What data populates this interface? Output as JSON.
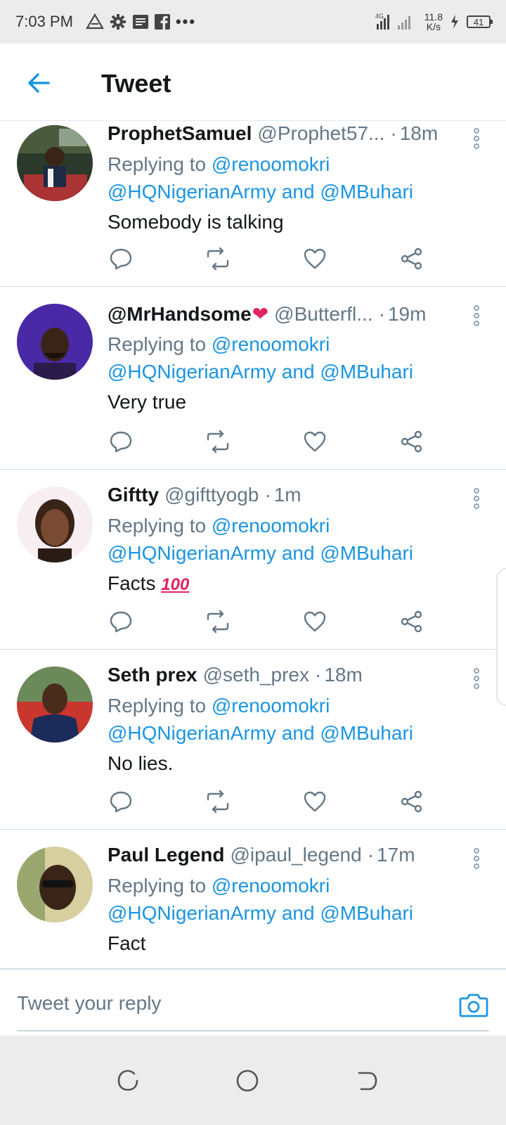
{
  "status_bar": {
    "time": "7:03 PM",
    "network": "4G",
    "speed_value": "11.8",
    "speed_unit": "K/s",
    "battery": "41",
    "icons": [
      "drive-icon",
      "gear-icon",
      "message-icon",
      "facebook-icon",
      "more-dots-icon"
    ]
  },
  "header": {
    "title": "Tweet",
    "back_icon": "back-arrow-icon"
  },
  "colors": {
    "accent": "#1b95e0",
    "muted": "#657786",
    "text": "#14171a",
    "divider": "#d6dde2"
  },
  "tweets": [
    {
      "name": "ProphetSamuel",
      "handle": "@Prophet57...",
      "sep": "·",
      "time": "18m",
      "replying_prefix": "Replying to",
      "mention_1": "@renoomokri",
      "mention_2": "@HQNigerianArmy",
      "and_word": "and",
      "mention_3": "@MBuhari",
      "text": "Somebody is talking"
    },
    {
      "name": "@MrHandsome",
      "name_emoji": "❤",
      "handle": "@Butterfl...",
      "sep": "·",
      "time": "19m",
      "replying_prefix": "Replying to",
      "mention_1": "@renoomokri",
      "mention_2": "@HQNigerianArmy",
      "and_word": "and",
      "mention_3": "@MBuhari",
      "text": "Very true"
    },
    {
      "name": "Giftty",
      "handle": "@gifttyogb",
      "sep": "·",
      "time": "1m",
      "replying_prefix": "Replying to",
      "mention_1": "@renoomokri",
      "mention_2": "@HQNigerianArmy",
      "and_word": "and",
      "mention_3": "@MBuhari",
      "text": "Facts",
      "text_emoji": "100"
    },
    {
      "name": "Seth prex",
      "handle": "@seth_prex",
      "sep": "·",
      "time": "18m",
      "replying_prefix": "Replying to",
      "mention_1": "@renoomokri",
      "mention_2": "@HQNigerianArmy",
      "and_word": "and",
      "mention_3": "@MBuhari",
      "text": "No lies."
    },
    {
      "name": "Paul Legend",
      "handle": "@ipaul_legend",
      "sep": "·",
      "time": "17m",
      "replying_prefix": "Replying to",
      "mention_1": "@renoomokri",
      "mention_2": "@HQNigerianArmy",
      "and_word": "and",
      "mention_3": "@MBuhari",
      "text": "Fact"
    }
  ],
  "reply_bar": {
    "placeholder": "Tweet your reply",
    "icon": "camera-icon"
  },
  "nav_bar": {
    "icons": [
      "recents-icon",
      "home-icon",
      "back-icon"
    ]
  }
}
